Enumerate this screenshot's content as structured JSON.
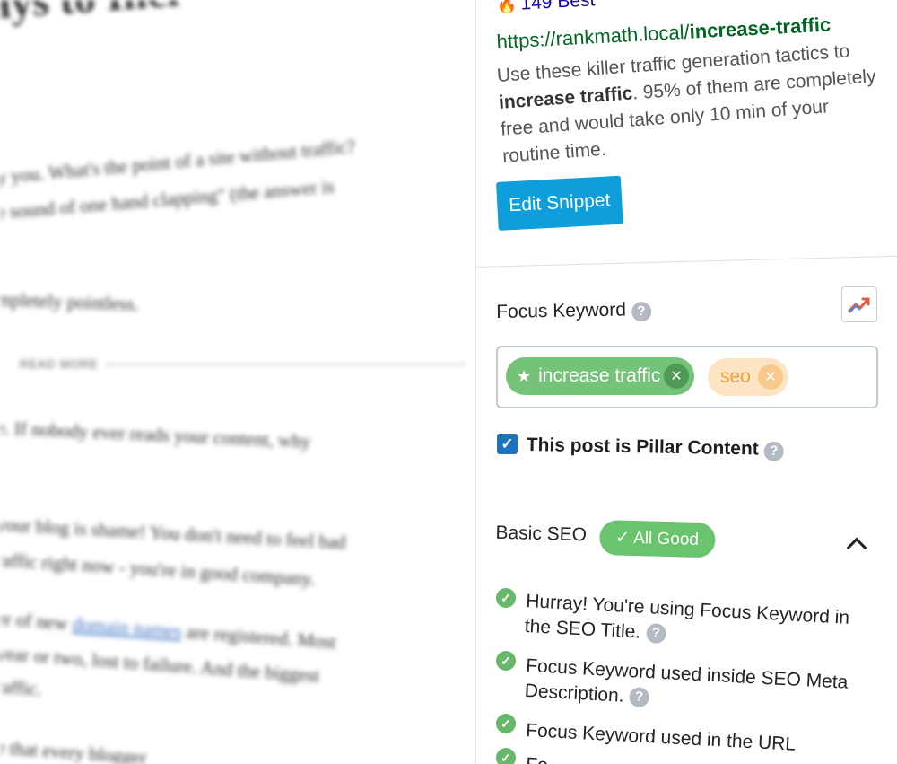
{
  "article": {
    "title_fragment": "ays to Incr",
    "lines": [
      "y you. What's the point of a site without traffic?",
      "e sound of one hand clapping\" (the answer is",
      "mpletely pointless.",
      "e. If nobody ever reads your content, why",
      "your blog is shame! You don't need to feel bad",
      "raffic right now - you're in good company.",
      "year or two, lost to failure. And the biggest",
      "raffic.",
      "e that every blogger"
    ],
    "line_10_prefix": "er of new ",
    "line_10_link": "domain names",
    "line_10_suffix": " are registered. Most",
    "read_more": "READ MORE"
  },
  "snippet": {
    "fire_icon": "fire-icon",
    "top_text": "149 Best",
    "url_prefix": "https://rankmath.local/",
    "url_bold": "increase-traffic",
    "desc_line1": "Use these killer traffic generation tactics to",
    "desc_bold": "increase traffic",
    "desc_line2_rest": ". 95% of them are completely",
    "desc_line3": "free and would take only 10 min of your",
    "desc_line4": "routine time."
  },
  "edit_snippet_label": "Edit Snippet",
  "focus_keyword": {
    "label": "Focus Keyword",
    "help": "?",
    "trend_icon": "trend-chart-icon",
    "keywords": [
      {
        "label": "increase traffic",
        "primary": true,
        "color": "#75c279"
      },
      {
        "label": "seo",
        "primary": false,
        "color": "#fde5c3"
      }
    ],
    "remove_symbol": "✕",
    "star_symbol": "★"
  },
  "pillar": {
    "checked": true,
    "label": "This post is Pillar Content",
    "help": "?"
  },
  "basic_seo": {
    "label": "Basic SEO",
    "badge": "✓ All Good",
    "badge_color": "#6ac46e",
    "checks": [
      {
        "line1": "Hurray! You're using Focus Keyword in",
        "line2": "the SEO Title."
      },
      {
        "line1": "Focus Keyword used inside SEO Meta",
        "line2": "Description."
      },
      {
        "line1": "Focus Keyword used in the URL",
        "line2": ""
      },
      {
        "line1": "Fo",
        "line2": ""
      }
    ],
    "help": "?"
  }
}
